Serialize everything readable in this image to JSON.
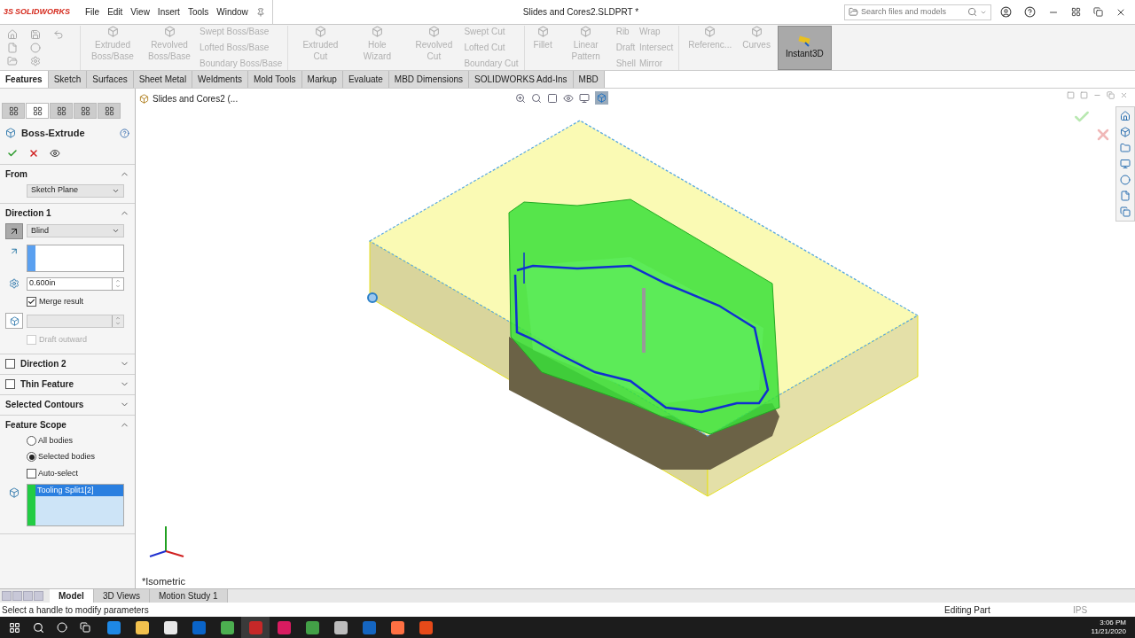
{
  "app": {
    "logo_prefix": "3S",
    "logo": "SOLIDWORKS"
  },
  "menu": [
    "File",
    "Edit",
    "View",
    "Insert",
    "Tools",
    "Window"
  ],
  "title": "Slides and Cores2.SLDPRT *",
  "search": {
    "placeholder": "Search files and models"
  },
  "ribbon": [
    [
      {
        "kind": "large",
        "label": "Extruded Boss/Base",
        "disabled": true
      },
      {
        "kind": "large",
        "label": "Revolved Boss/Base",
        "disabled": true
      },
      {
        "kind": "stack",
        "items": [
          {
            "label": "Swept Boss/Base",
            "disabled": true
          },
          {
            "label": "Lofted Boss/Base",
            "disabled": true
          },
          {
            "label": "Boundary Boss/Base",
            "disabled": true
          }
        ]
      }
    ],
    [
      {
        "kind": "large",
        "label": "Extruded Cut",
        "disabled": true
      },
      {
        "kind": "large",
        "label": "Hole Wizard",
        "disabled": true
      },
      {
        "kind": "large",
        "label": "Revolved Cut",
        "disabled": true
      },
      {
        "kind": "stack",
        "items": [
          {
            "label": "Swept Cut",
            "disabled": true
          },
          {
            "label": "Lofted Cut",
            "disabled": true
          },
          {
            "label": "Boundary Cut",
            "disabled": true
          }
        ]
      }
    ],
    [
      {
        "kind": "large",
        "label": "Fillet",
        "disabled": true
      },
      {
        "kind": "large",
        "label": "Linear Pattern",
        "disabled": true
      },
      {
        "kind": "stack",
        "items": [
          {
            "label": "Rib",
            "disabled": true
          },
          {
            "label": "Draft",
            "disabled": true
          },
          {
            "label": "Shell",
            "disabled": true
          }
        ]
      },
      {
        "kind": "stack",
        "items": [
          {
            "label": "Wrap",
            "disabled": true
          },
          {
            "label": "Intersect",
            "disabled": true
          },
          {
            "label": "Mirror",
            "disabled": true
          }
        ]
      }
    ],
    [
      {
        "kind": "large",
        "label": "Referenc...",
        "disabled": true
      },
      {
        "kind": "large",
        "label": "Curves",
        "disabled": true
      },
      {
        "kind": "toggle",
        "label": "Instant3D",
        "on": true
      }
    ]
  ],
  "command_tabs": [
    {
      "label": "Features",
      "selected": true
    },
    {
      "label": "Sketch",
      "selected": false
    },
    {
      "label": "Surfaces",
      "selected": false
    },
    {
      "label": "Sheet Metal",
      "selected": false
    },
    {
      "label": "Weldments",
      "selected": false
    },
    {
      "label": "Mold Tools",
      "selected": false
    },
    {
      "label": "Markup",
      "selected": false
    },
    {
      "label": "Evaluate",
      "selected": false
    },
    {
      "label": "MBD Dimensions",
      "selected": false
    },
    {
      "label": "SOLIDWORKS Add-Ins",
      "selected": false
    },
    {
      "label": "MBD",
      "selected": false
    }
  ],
  "panel_tabs": [
    {
      "selected": false
    },
    {
      "selected": true
    },
    {
      "selected": false
    },
    {
      "selected": false
    },
    {
      "selected": false
    }
  ],
  "property_manager": {
    "title": "Boss-Extrude",
    "sections": [
      {
        "kind": "from",
        "title": "From",
        "expanded": true,
        "value": "Sketch Plane"
      },
      {
        "kind": "direction",
        "title": "Direction 1",
        "expanded": true,
        "end": "Blind",
        "depth": "0.600in",
        "merge": {
          "label": "Merge result",
          "checked": true
        },
        "draft": {
          "label": "Draft outward",
          "checked": false,
          "disabled": true
        }
      },
      {
        "kind": "check",
        "title": "Direction 2",
        "checked": false,
        "expanded": false
      },
      {
        "kind": "check",
        "title": "Thin Feature",
        "checked": false,
        "expanded": false
      },
      {
        "kind": "plain",
        "title": "Selected Contours",
        "expanded": false
      },
      {
        "kind": "scope",
        "title": "Feature Scope",
        "expanded": true,
        "options": [
          {
            "label": "All bodies",
            "selected": false
          },
          {
            "label": "Selected bodies",
            "selected": true
          }
        ],
        "auto": {
          "label": "Auto-select",
          "checked": false
        },
        "bodies": [
          {
            "label": "Tooling Split1[2]",
            "selected": true
          }
        ]
      }
    ]
  },
  "tree_path": "Slides and Cores2  (...",
  "view_label": "*Isometric",
  "bottom_tabs": [
    {
      "label": "Model",
      "selected": true
    },
    {
      "label": "3D Views",
      "selected": false
    },
    {
      "label": "Motion Study 1",
      "selected": false
    }
  ],
  "status_bar": {
    "message": "Select a handle to modify parameters",
    "mode": "Editing Part",
    "units": "IPS"
  },
  "taskbar": {
    "apps": [
      {
        "color": "#1e88e5",
        "active": false
      },
      {
        "color": "#f2c14e",
        "active": false
      },
      {
        "color": "#e8e8e8",
        "active": false
      },
      {
        "color": "#0a64c8",
        "active": false
      },
      {
        "color": "#4caf50",
        "active": false
      },
      {
        "color": "#c62828",
        "active": true
      },
      {
        "color": "#d81b60",
        "active": false
      },
      {
        "color": "#43a047",
        "active": false
      },
      {
        "color": "#bdbdbd",
        "active": false
      },
      {
        "color": "#1565c0",
        "active": false
      },
      {
        "color": "#ff7043",
        "active": false
      },
      {
        "color": "#e64a19",
        "active": false
      }
    ],
    "time": "3:06 PM",
    "date": "11/21/2020"
  }
}
